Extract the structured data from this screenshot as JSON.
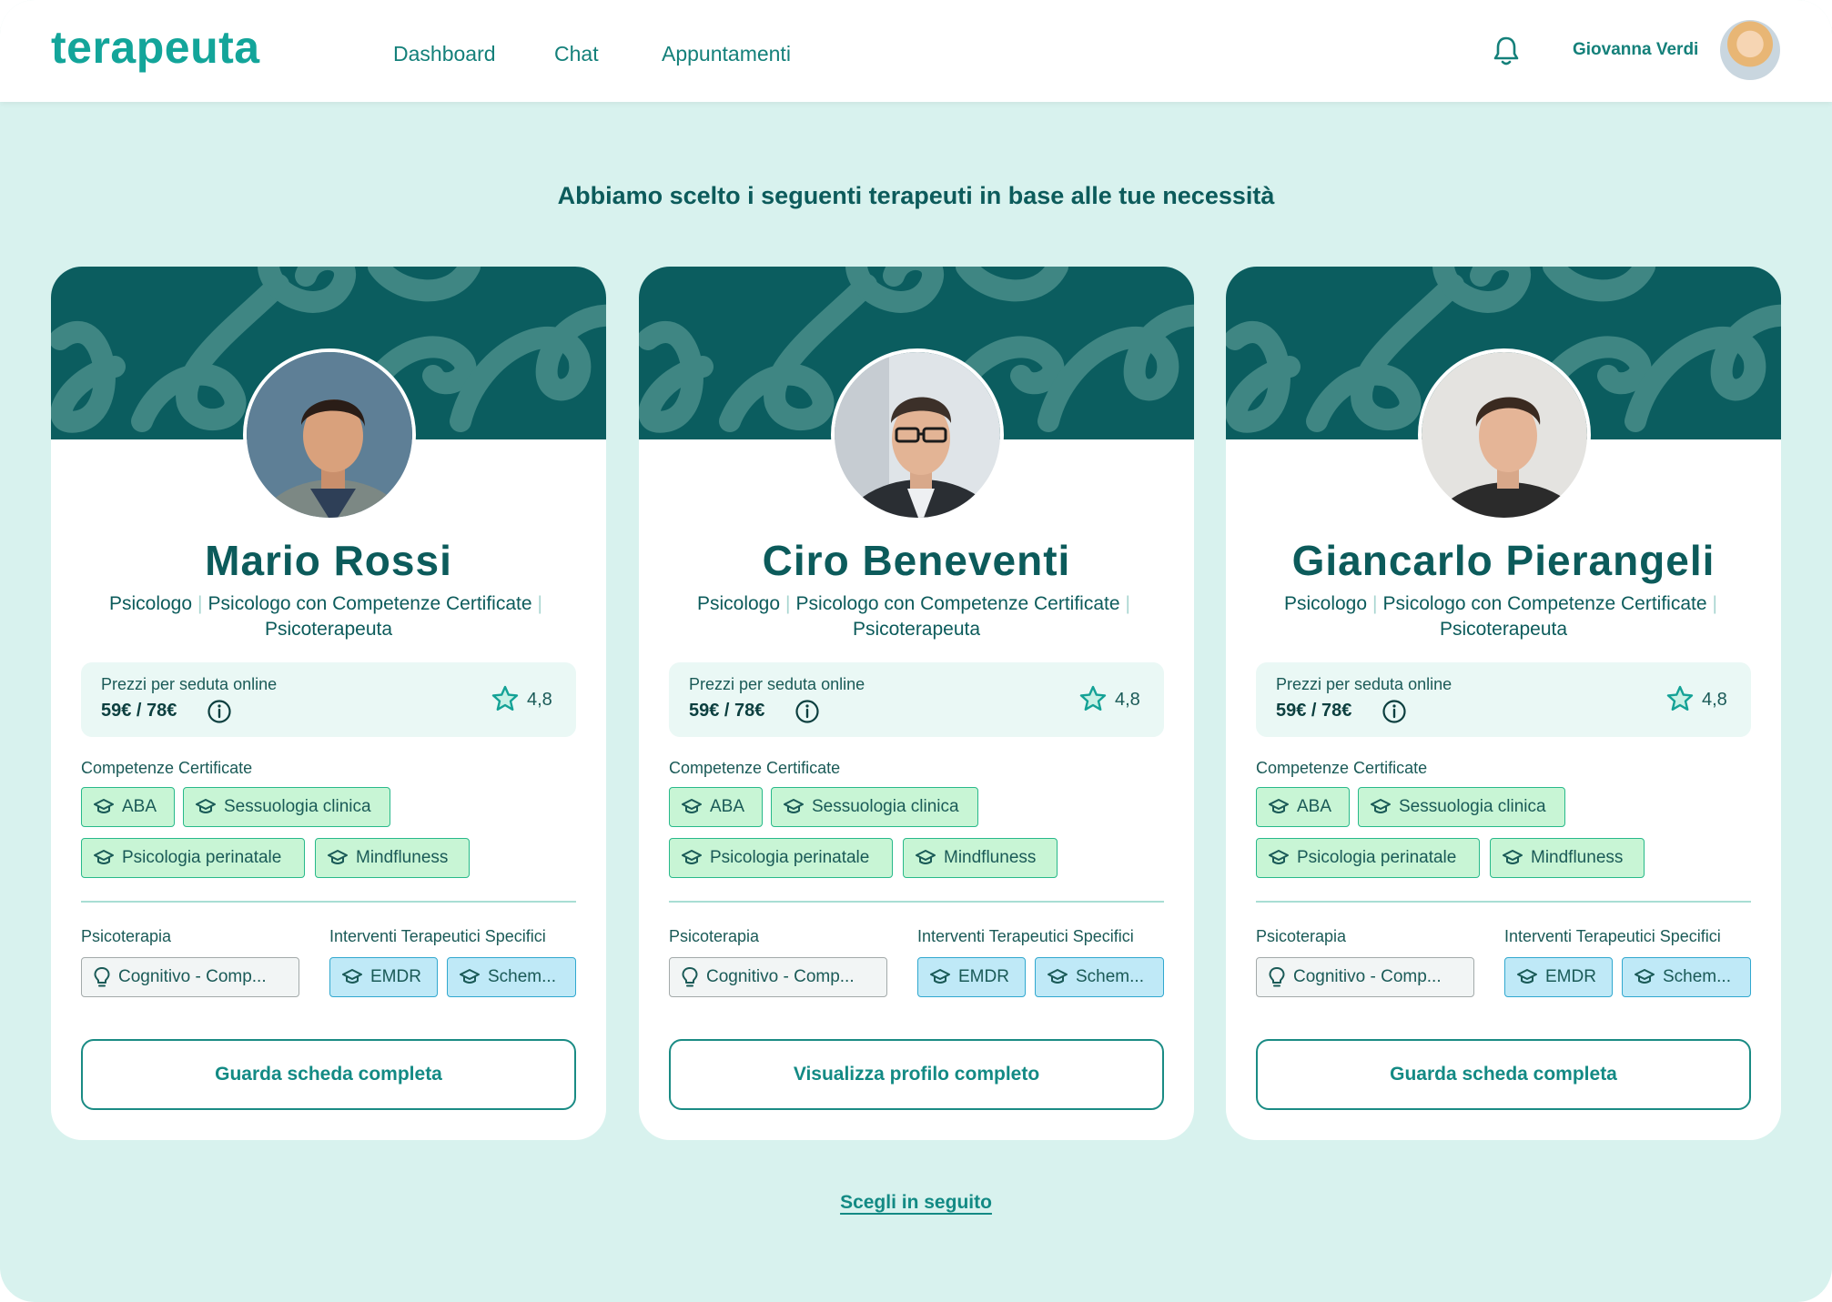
{
  "app": {
    "logo_text": "terapeuta"
  },
  "nav": {
    "items": [
      {
        "label": "Dashboard"
      },
      {
        "label": "Chat"
      },
      {
        "label": "Appuntamenti"
      }
    ]
  },
  "user": {
    "name": "Giovanna Verdi"
  },
  "page": {
    "heading": "Abbiamo scelto i seguenti terapeuti in base alle tue necessità",
    "later_link": "Scegli in seguito"
  },
  "icons": {
    "notifications": "bell-icon",
    "price_info": "info-icon",
    "rating": "star-icon",
    "certificate": "graduation-cap-icon",
    "psychotherapy": "lightbulb-icon"
  },
  "colors": {
    "brand_teal": "#13a59a",
    "banner": "#0b5d5f",
    "background": "#d8f2ee",
    "chip_green": "#c8f5d5",
    "chip_blue": "#bfe9f7"
  },
  "cards": [
    {
      "name": "Mario Rossi",
      "roles": [
        "Psicologo",
        "Psicologo con Competenze Certificate",
        "Psicoterapeuta"
      ],
      "price_label": "Prezzi per seduta online",
      "price": "59€ / 78€",
      "rating": "4,8",
      "competenze_label": "Competenze Certificate",
      "competenze": [
        "ABA",
        "Sessuologia clinica",
        "Psicologia perinatale",
        "Mindfluness"
      ],
      "psicoterapia_label": "Psicoterapia",
      "psicoterapia": "Cognitivo - Comp...",
      "interventi_label": "Interventi Terapeutici Specifici",
      "interventi": [
        "EMDR",
        "Schem..."
      ],
      "cta": "Guarda scheda completa"
    },
    {
      "name": "Ciro Beneventi",
      "roles": [
        "Psicologo",
        "Psicologo con Competenze Certificate",
        "Psicoterapeuta"
      ],
      "price_label": "Prezzi per seduta online",
      "price": "59€ / 78€",
      "rating": "4,8",
      "competenze_label": "Competenze Certificate",
      "competenze": [
        "ABA",
        "Sessuologia clinica",
        "Psicologia perinatale",
        "Mindfluness"
      ],
      "psicoterapia_label": "Psicoterapia",
      "psicoterapia": "Cognitivo - Comp...",
      "interventi_label": "Interventi Terapeutici Specifici",
      "interventi": [
        "EMDR",
        "Schem..."
      ],
      "cta": "Visualizza profilo completo"
    },
    {
      "name": "Giancarlo Pierangeli",
      "roles": [
        "Psicologo",
        "Psicologo con Competenze Certificate",
        "Psicoterapeuta"
      ],
      "price_label": "Prezzi per seduta online",
      "price": "59€ / 78€",
      "rating": "4,8",
      "competenze_label": "Competenze Certificate",
      "competenze": [
        "ABA",
        "Sessuologia clinica",
        "Psicologia perinatale",
        "Mindfluness"
      ],
      "psicoterapia_label": "Psicoterapia",
      "psicoterapia": "Cognitivo - Comp...",
      "interventi_label": "Interventi Terapeutici Specifici",
      "interventi": [
        "EMDR",
        "Schem..."
      ],
      "cta": "Guarda scheda completa"
    }
  ]
}
